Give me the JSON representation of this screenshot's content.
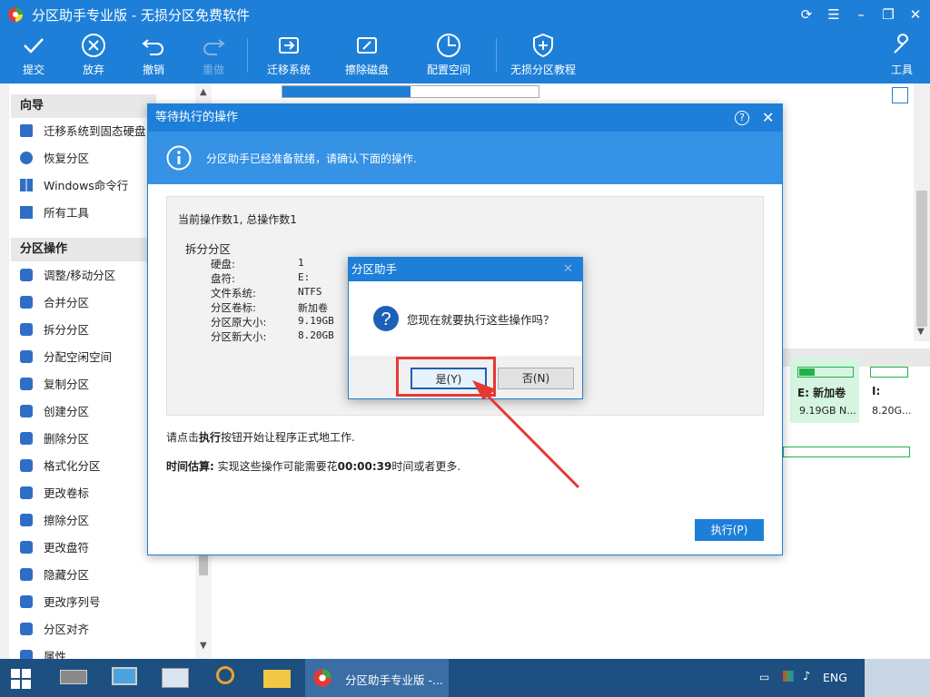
{
  "app": {
    "title": "分区助手专业版 - 无损分区免费软件"
  },
  "toolbar": {
    "commit": "提交",
    "discard": "放弃",
    "undo": "撤销",
    "redo": "重做",
    "migrate": "迁移系统",
    "wipe": "擦除磁盘",
    "allocate": "配置空间",
    "tutorial": "无损分区教程",
    "tools": "工具"
  },
  "sidebar": {
    "wizard_title": "向导",
    "wizard_items": [
      "迁移系统到固态硬盘",
      "恢复分区",
      "Windows命令行",
      "所有工具"
    ],
    "ops_title": "分区操作",
    "ops_items": [
      "调整/移动分区",
      "合并分区",
      "拆分分区",
      "分配空闲空间",
      "复制分区",
      "创建分区",
      "删除分区",
      "格式化分区",
      "更改卷标",
      "擦除分区",
      "更改盘符",
      "隐藏分区",
      "更改序列号",
      "分区对齐",
      "属性"
    ]
  },
  "right_panel": {
    "e_label": "E: 新加卷",
    "e_size": "9.19GB N...",
    "i_label": "I:",
    "i_size": "8.20G..."
  },
  "dialog": {
    "title": "等待执行的操作",
    "banner": "分区助手已经准备就绪，请确认下面的操作.",
    "ops_count": "当前操作数1, 总操作数1",
    "op_name": "拆分分区",
    "details": [
      {
        "key": "硬盘:",
        "value": "1"
      },
      {
        "key": "盘符:",
        "value": "E:"
      },
      {
        "key": "文件系统:",
        "value": "NTFS"
      },
      {
        "key": "分区卷标:",
        "value": "新加卷"
      },
      {
        "key": "分区原大小:",
        "value": "9.19GB"
      },
      {
        "key": "分区新大小:",
        "value": "8.20GB"
      }
    ],
    "hint_pre": "请点击",
    "hint_bold": "执行",
    "hint_post": "按钮开始让程序正式地工作.",
    "estimate_label": "时间估算:",
    "estimate_pre": " 实现这些操作可能需要花",
    "estimate_time": "00:00:39",
    "estimate_post": "时间或者更多.",
    "execute_button": "执行(P)"
  },
  "confirm": {
    "title": "分区助手",
    "question": "您现在就要执行这些操作吗？",
    "yes": "是(Y)",
    "no": "否(N)"
  },
  "taskbar": {
    "active_app": "分区助手专业版 -...",
    "lang": "ENG"
  },
  "colors": {
    "accent": "#1e7fd8",
    "highlight": "#e53935",
    "disk_green": "#22b14c"
  }
}
